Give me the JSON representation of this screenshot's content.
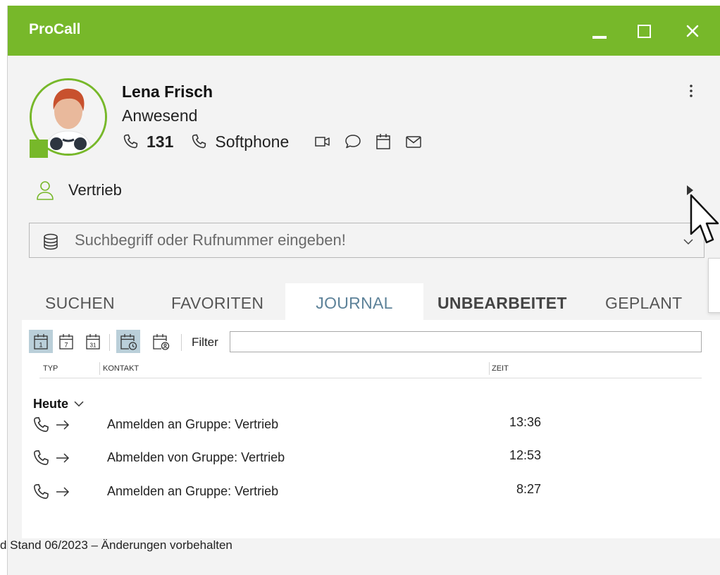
{
  "window": {
    "title": "ProCall"
  },
  "profile": {
    "name": "Lena Frisch",
    "status": "Anwesend",
    "extension": "131",
    "phone_device": "Softphone"
  },
  "group": {
    "name": "Vertrieb"
  },
  "search": {
    "placeholder": "Suchbegriff oder Rufnummer eingeben!"
  },
  "tabs": [
    {
      "label": "SUCHEN"
    },
    {
      "label": "FAVORITEN"
    },
    {
      "label": "JOURNAL",
      "active": true
    },
    {
      "label": "UNBEARBEITET",
      "bold": true
    },
    {
      "label": "GEPLANT"
    }
  ],
  "journal": {
    "toolbar": {
      "day1": "1",
      "day7": "7",
      "day31": "31",
      "filter_label": "Filter",
      "filter_value": ""
    },
    "columns": {
      "type": "TYP",
      "contact": "KONTAKT",
      "time": "ZEIT"
    },
    "group_label": "Heute",
    "rows": [
      {
        "type_icon": "phone-outgoing-icon",
        "contact": "Anmelden an Gruppe: Vertrieb",
        "time": "13:36"
      },
      {
        "type_icon": "phone-outgoing-icon",
        "contact": "Abmelden von Gruppe: Vertrieb",
        "time": "12:53"
      },
      {
        "type_icon": "phone-outgoing-icon",
        "contact": "Anmelden an Gruppe: Vertrieb",
        "time": "8:27"
      }
    ]
  },
  "footer": {
    "text": "d Stand 06/2023 – Änderungen vorbehalten"
  },
  "colors": {
    "accent": "#77b82a",
    "tab_active": "#5d8299",
    "toolbar_selected": "#bacfd9"
  }
}
